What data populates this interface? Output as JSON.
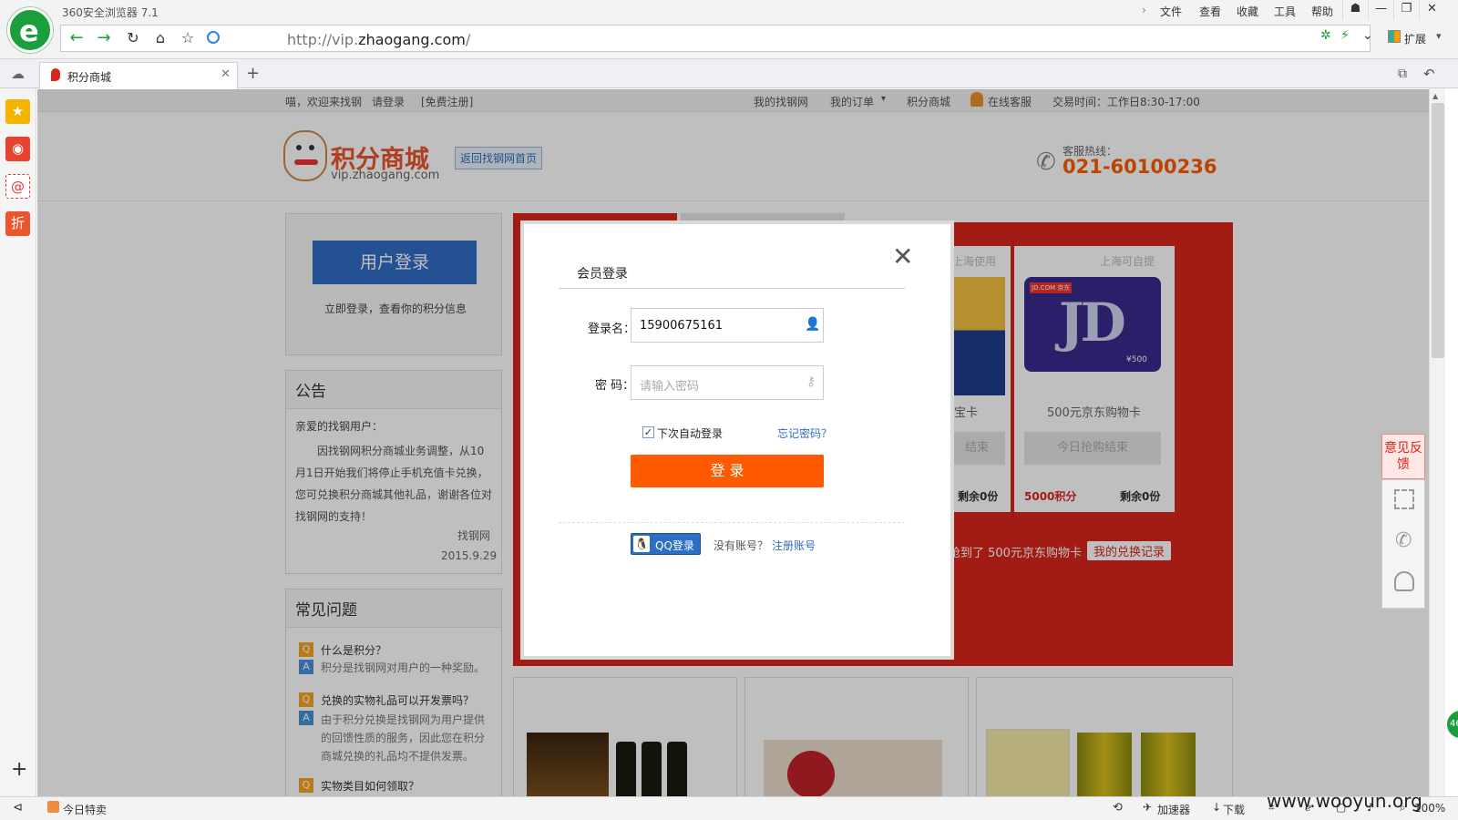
{
  "browser": {
    "title": "360安全浏览器 7.1",
    "menu": [
      "文件",
      "查看",
      "收藏",
      "工具",
      "帮助"
    ],
    "url_prefix": "http://vip.",
    "url_domain": "zhaogang.com",
    "url_suffix": "/",
    "extend_label": "扩展",
    "tab_title": "积分商城",
    "new_tab": "+",
    "status": {
      "today_deals": "今日特卖",
      "accelerator": "加速器",
      "download": "下载",
      "zoom": "100%",
      "watermark": "www.wooyun.org",
      "float_badge": "46"
    }
  },
  "site": {
    "topnav_left": [
      "喵，欢迎来找钢",
      "请登录",
      "[免费注册]"
    ],
    "topnav_right": [
      "我的找钢网",
      "我的订单",
      "积分商城",
      "在线客服",
      "交易时间：工作日8:30-17:00"
    ],
    "brand_name": "积分商城",
    "brand_url": "vip.zhaogang.com",
    "back_home": "返回找钢网首页",
    "hotline_label": "客服热线：",
    "hotline": "021-60100236",
    "login_btn": "用户登录",
    "login_tip": "立即登录，查看你的积分信息",
    "notice_title": "公告",
    "notice_greeting": "亲爱的找钢用户：",
    "notice_body": "因找钢网积分商城业务调整，从10月1日开始我们将停止手机充值卡兑换，您可兑换积分商城其他礼品，谢谢各位对找钢网的支持！",
    "notice_sign": "找钢网",
    "notice_date": "2015.9.29",
    "faq_title": "常见问题",
    "faq": [
      {
        "q": "什么是积分？",
        "a": "积分是找钢网对用户的一种奖励。"
      },
      {
        "q": "兑换的实物礼品可以开发票吗？",
        "a": "由于积分兑换是找钢网为用户提供的回馈性质的服务，因此您在积分商城兑换的礼品均不提供发票。"
      },
      {
        "q": "实物类目如何领取？",
        "a": ""
      }
    ],
    "card_left": {
      "region": "上海使用",
      "title": "宝卡",
      "btn": "结束",
      "remain": "剩余0份"
    },
    "card_right": {
      "region": "上海可自提",
      "title": "500元京东购物卡",
      "btn": "今日抢购结束",
      "points": "5000积分",
      "remain": "剩余0份",
      "card_value": "¥500",
      "card_brand": "JD.COM 京东"
    },
    "ticker": "抢到了 500元京东购物卡",
    "exchange_record": "我的兑换记录",
    "feedback": "意见反馈"
  },
  "modal": {
    "title": "会员登录",
    "username_label": "登录名：",
    "username_value": "15900675161",
    "password_label": "密 码：",
    "password_placeholder": "请输入密码",
    "remember_label": "下次自动登录",
    "remember_checked": true,
    "forgot": "忘记密码？",
    "submit": "登 录",
    "qq_login": "QQ登录",
    "no_account": "没有账号？",
    "register": "注册账号"
  },
  "colors": {
    "accent_orange": "#ff5a00",
    "brand_blue": "#2f6cc4",
    "promo_red": "#d9261c",
    "browser_green": "#1a9f3c"
  }
}
